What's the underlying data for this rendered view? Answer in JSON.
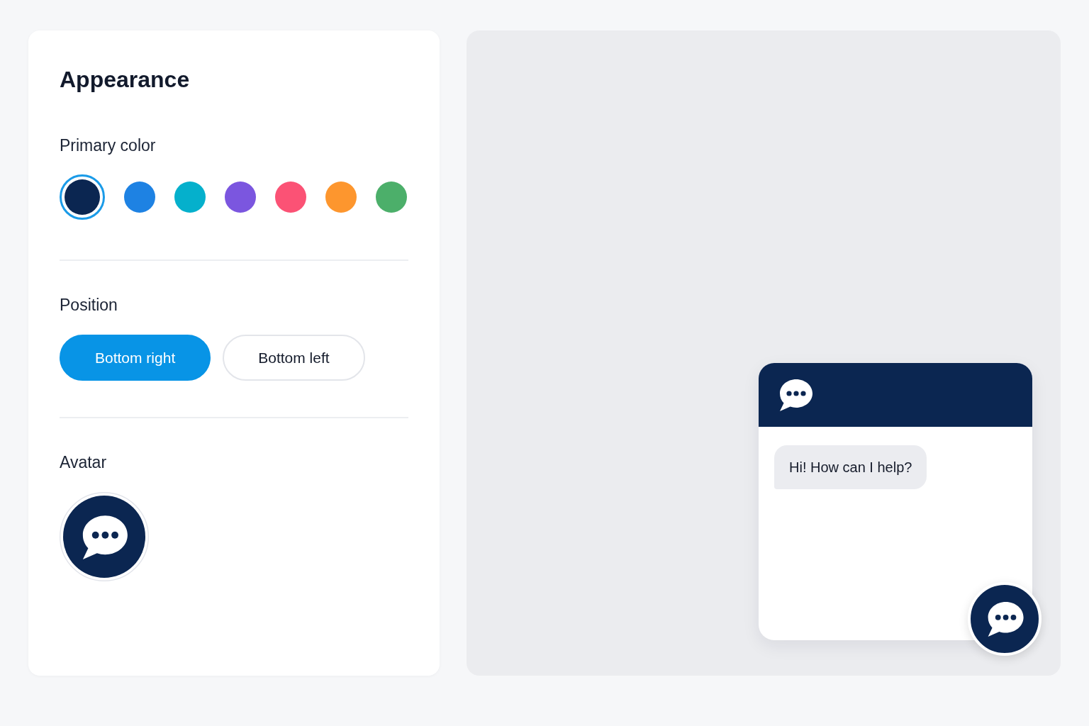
{
  "settings": {
    "title": "Appearance",
    "primary_color": {
      "label": "Primary color",
      "swatches": [
        {
          "color": "#0b2651",
          "selected": true
        },
        {
          "color": "#1e82e3",
          "selected": false
        },
        {
          "color": "#05b0cc",
          "selected": false
        },
        {
          "color": "#7b56df",
          "selected": false
        },
        {
          "color": "#fb5275",
          "selected": false
        },
        {
          "color": "#fd962e",
          "selected": false
        },
        {
          "color": "#4caf6a",
          "selected": false
        }
      ]
    },
    "position": {
      "label": "Position",
      "options": [
        {
          "label": "Bottom right",
          "selected": true
        },
        {
          "label": "Bottom left",
          "selected": false
        }
      ]
    },
    "avatar": {
      "label": "Avatar"
    }
  },
  "preview": {
    "messages": [
      {
        "text": "Hi! How can I help?"
      }
    ]
  }
}
